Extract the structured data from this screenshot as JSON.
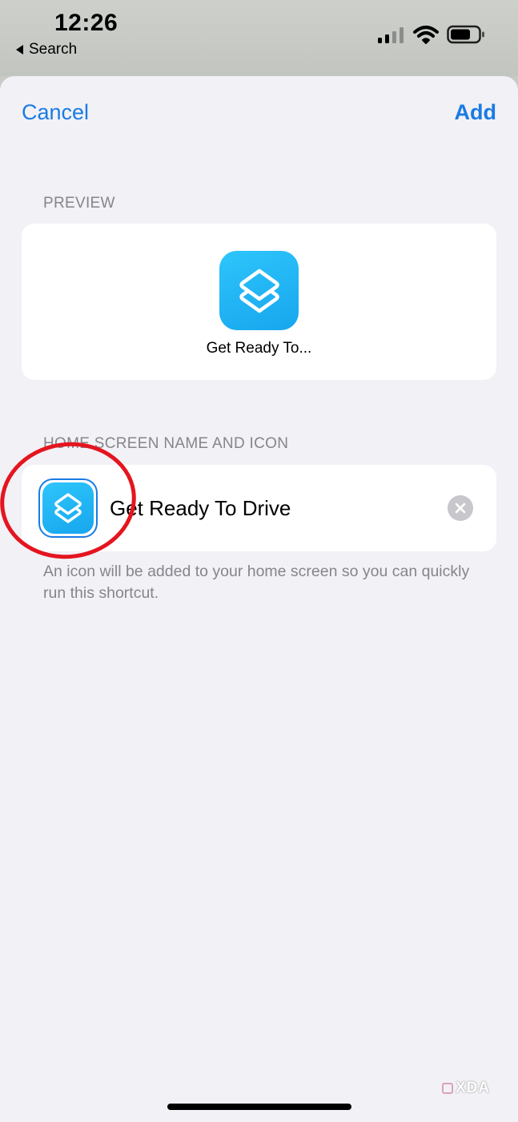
{
  "status_bar": {
    "time": "12:26",
    "back_label": "Search",
    "icons": [
      "cellular-signal-icon",
      "wifi-icon",
      "battery-icon"
    ]
  },
  "nav": {
    "cancel_label": "Cancel",
    "add_label": "Add"
  },
  "preview": {
    "header": "PREVIEW",
    "app_label": "Get Ready To...",
    "icon": "shortcuts-icon",
    "icon_color": "#1fb1f4"
  },
  "home_screen": {
    "header": "HOME SCREEN NAME AND ICON",
    "name_value": "Get Ready To Drive",
    "icon": "shortcuts-icon",
    "clear_icon": "clear-icon",
    "footnote": "An icon will be added to your home screen so you can quickly run this shortcut."
  },
  "watermark": "XDA",
  "colors": {
    "accent": "#1a7be4",
    "annotation": "#e4151f",
    "background": "#f2f1f6",
    "secondary_text": "#86858b"
  }
}
